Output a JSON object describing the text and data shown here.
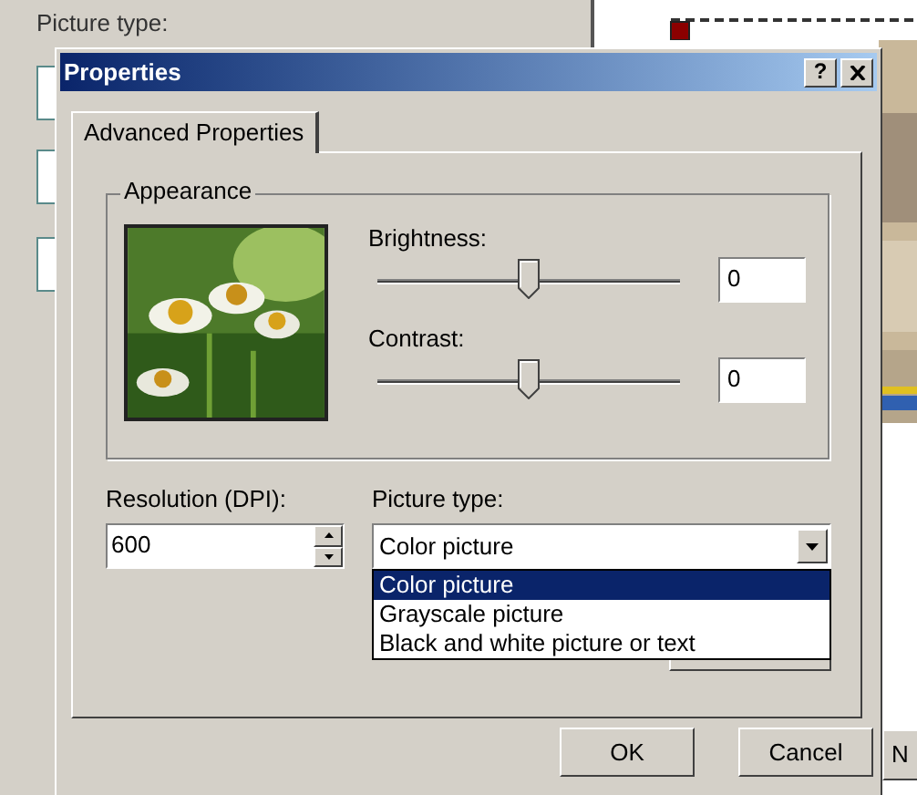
{
  "background_window": {
    "label": "Picture type:",
    "button_text": "N"
  },
  "dialog": {
    "title": "Properties",
    "help_button": "?",
    "tabs": [
      {
        "label": "Advanced Properties",
        "selected": true
      }
    ],
    "appearance": {
      "title": "Appearance",
      "sliders": [
        {
          "label": "Brightness:",
          "level": 0.5,
          "value": "0"
        },
        {
          "label": "Contrast:",
          "level": 0.5,
          "value": "0"
        }
      ]
    },
    "resolution": {
      "label": "Resolution (DPI):",
      "value": "600"
    },
    "picture_type": {
      "label": "Picture type:",
      "value": "Color picture",
      "expanded": true,
      "options": [
        {
          "label": "Color picture",
          "selected": true
        },
        {
          "label": "Grayscale picture",
          "selected": false
        },
        {
          "label": "Black and white picture or text",
          "selected": false
        }
      ]
    },
    "buttons": [
      {
        "label": "OK"
      },
      {
        "label": "Cancel"
      }
    ]
  }
}
